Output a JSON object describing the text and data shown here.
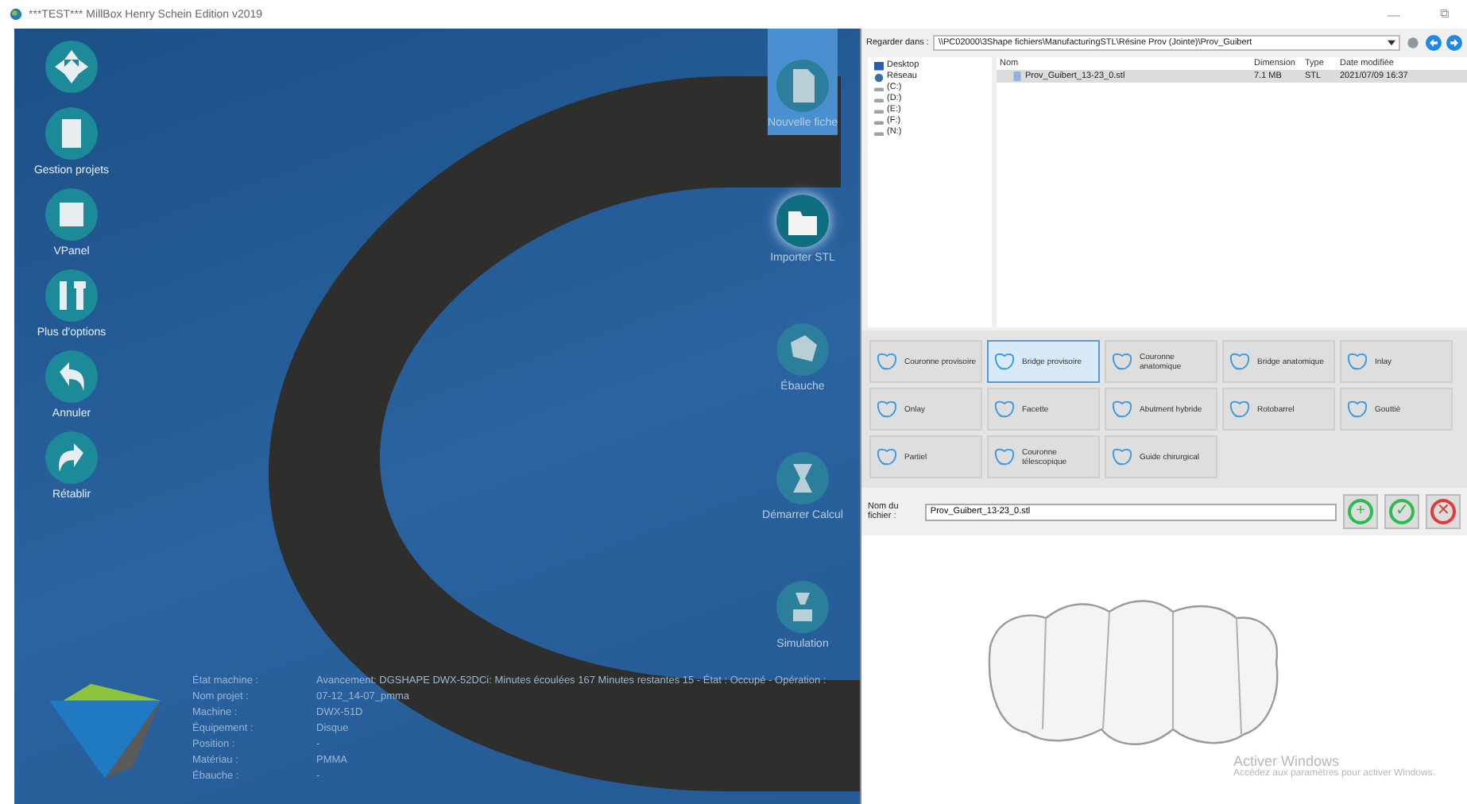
{
  "window": {
    "title": "***TEST*** MillBox Henry Schein Edition v2019",
    "controls": [
      "—",
      "⧉"
    ]
  },
  "left_toolbar": [
    {
      "kind": "nav"
    },
    {
      "kind": "projects",
      "label": "Gestion projets"
    },
    {
      "kind": "vpanel",
      "label": "VPanel"
    },
    {
      "kind": "options",
      "label": "Plus d'options"
    },
    {
      "kind": "undo",
      "label": "Annuler"
    },
    {
      "kind": "redo",
      "label": "Rétablir"
    }
  ],
  "right_toolbar": [
    {
      "kind": "new",
      "label": "Nouvelle fiche",
      "selected": false,
      "highlighted": true
    },
    {
      "kind": "import",
      "label": "Importer STL",
      "selected": true,
      "highlighted": false
    },
    {
      "kind": "blank",
      "label": "Ébauche",
      "selected": false,
      "highlighted": false
    },
    {
      "kind": "calc",
      "label": "Démarrer Calcul",
      "selected": false,
      "highlighted": false
    },
    {
      "kind": "sim",
      "label": "Simulation",
      "selected": false,
      "highlighted": false
    }
  ],
  "status": [
    {
      "label": "État machine :",
      "value": "Avancement: DGSHAPE DWX-52DCi: Minutes écoulées 167 Minutes restantes 15 - État : Occupé - Opération :"
    },
    {
      "label": "Nom projet :",
      "value": "07-12_14-07_pmma"
    },
    {
      "label": "Machine :",
      "value": "DWX-51D"
    },
    {
      "label": "Équipement :",
      "value": "Disque"
    },
    {
      "label": "Position :",
      "value": "-"
    },
    {
      "label": "Matériau :",
      "value": "PMMA"
    },
    {
      "label": "Ébauche :",
      "value": "-"
    }
  ],
  "file_dialog": {
    "look_in_label": "Regarder dans :",
    "path": "\\\\PC02000\\3Shape fichiers\\ManufacturingSTL\\Résine Prov (Jointe)\\Prov_Guibert",
    "tree": [
      {
        "kind": "desktop",
        "label": "Desktop"
      },
      {
        "kind": "network",
        "label": "Réseau"
      },
      {
        "kind": "drive",
        "label": "(C:)"
      },
      {
        "kind": "drive",
        "label": "(D:)"
      },
      {
        "kind": "drive",
        "label": "(E:)"
      },
      {
        "kind": "drive",
        "label": "(F:)"
      },
      {
        "kind": "drive",
        "label": "(N:)"
      }
    ],
    "columns": [
      "Nom",
      "Dimension",
      "Type",
      "Date modifiée"
    ],
    "rows": [
      {
        "name": "Prov_Guibert_13-23_0.stl",
        "size": "7.1 MB",
        "type": "STL",
        "date": "2021/07/09 16:37",
        "selected": true
      }
    ],
    "restoration_types": [
      {
        "label": "Couronne provisoire",
        "selected": false
      },
      {
        "label": "Bridge provisoire",
        "selected": true
      },
      {
        "label": "Couronne anatomique",
        "selected": false
      },
      {
        "label": "Bridge anatomique",
        "selected": false
      },
      {
        "label": "Inlay",
        "selected": false
      },
      {
        "label": "Onlay",
        "selected": false
      },
      {
        "label": "Facette",
        "selected": false
      },
      {
        "label": "Abutment hybride",
        "selected": false
      },
      {
        "label": "Rotobarrel",
        "selected": false
      },
      {
        "label": "Gouttiè",
        "selected": false
      },
      {
        "label": "Partiel",
        "selected": false
      },
      {
        "label": "Couronne télescopique",
        "selected": false
      },
      {
        "label": "Guide chirurgical",
        "selected": false
      }
    ],
    "filename_label": "Nom du fichier :",
    "filename": "Prov_Guibert_13-23_0.stl",
    "actions": [
      {
        "kind": "add",
        "label": "+"
      },
      {
        "kind": "ok",
        "label": "✓"
      },
      {
        "kind": "cancel",
        "label": "✕"
      }
    ]
  },
  "os_notice": {
    "title": "Activer Windows",
    "text": "Accédez aux paramètres pour activer Windows."
  }
}
